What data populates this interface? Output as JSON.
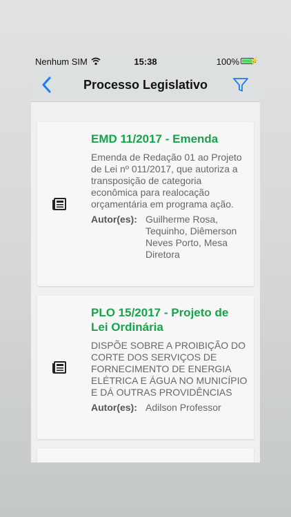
{
  "status_bar": {
    "carrier": "Nenhum SIM",
    "time": "15:38",
    "battery_percent": "100%",
    "battery_level": 1.0,
    "battery_color": "#4cd964"
  },
  "nav": {
    "title": "Processo Legislativo",
    "back_icon": "chevron-left-icon",
    "filter_icon": "filter-icon",
    "accent_color": "#1a7cf2"
  },
  "items": [
    {
      "title": "EMD 11/2017 - Emenda",
      "description": "Emenda de Redação 01 ao Projeto de Lei nº 011/2017, que autoriza a transposição de categoria econômica para realocação orçamentária em programa ação.",
      "authors_label": "Autor(es):",
      "authors": "Guilherme Rosa, Tequinho, Diêmerson Neves Porto, Mesa Diretora",
      "icon": "newspaper-icon"
    },
    {
      "title": "PLO 15/2017 - Projeto de Lei Ordinária",
      "description": "DISPÕE SOBRE A PROIBIÇÃO DO CORTE DOS SERVIÇOS DE FORNECIMENTO DE ENERGIA ELÉTRICA E ÁGUA NO MUNICÍPIO E DÁ OUTRAS PROVIDÊNCIAS",
      "authors_label": "Autor(es):",
      "authors": "Adilson Professor",
      "icon": "newspaper-icon"
    }
  ],
  "title_color": "#17a34a"
}
